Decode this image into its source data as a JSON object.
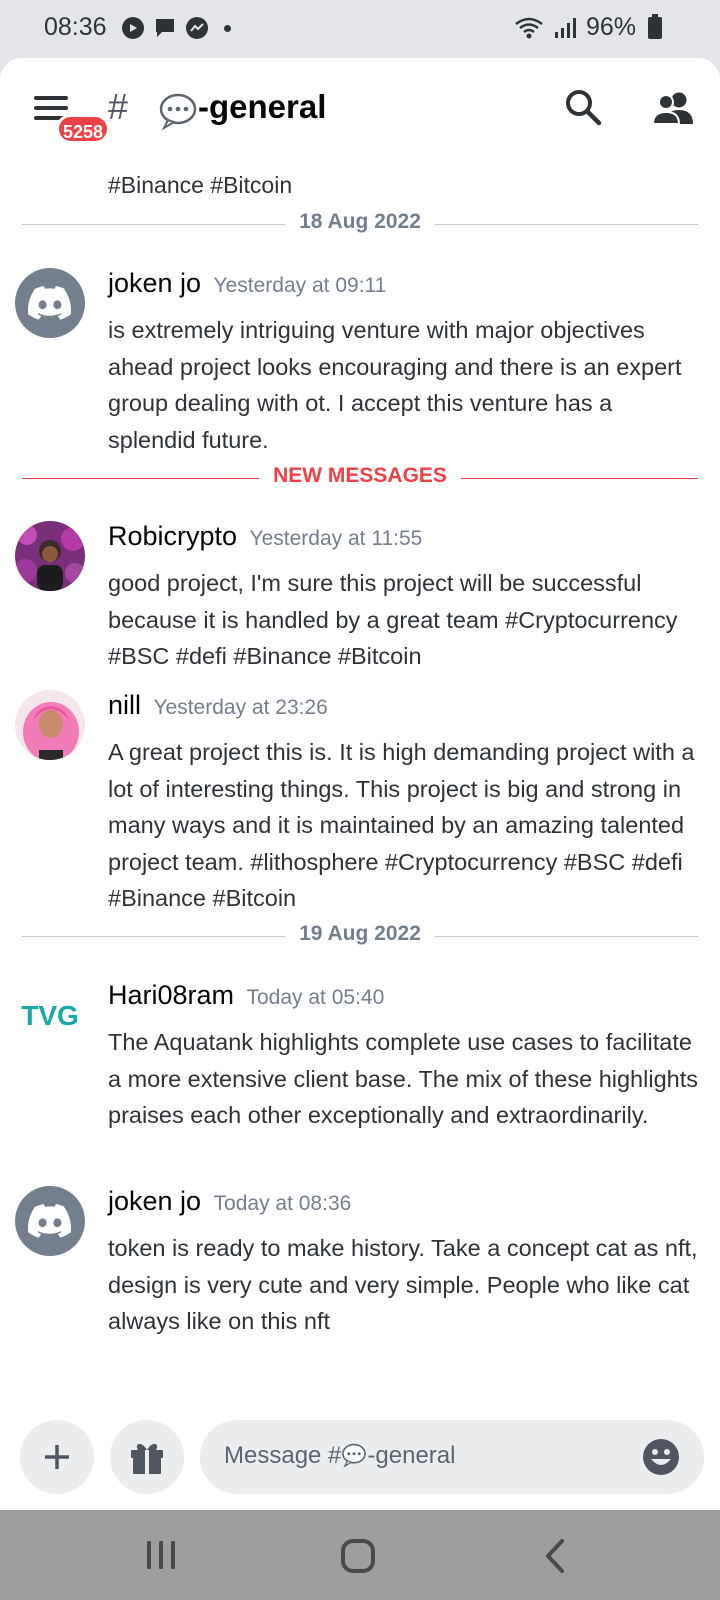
{
  "status_bar": {
    "time": "08:36",
    "battery": "96%",
    "icons": [
      "play-icon",
      "message-icon",
      "messenger-icon",
      "dot-icon",
      "wifi-icon",
      "signal-icon",
      "battery-icon"
    ]
  },
  "header": {
    "unread_badge": "5258",
    "hash_symbol": "#",
    "channel_name": "-general",
    "icons": [
      "menu-icon",
      "speech-bubble-emoji",
      "search-icon",
      "members-icon"
    ]
  },
  "chat": {
    "cut_off_text": "#Binance #Bitcoin",
    "dividers": {
      "first": "18 Aug 2022",
      "new_messages": "NEW MESSAGES",
      "second": "19 Aug 2022"
    },
    "messages": [
      {
        "author": "joken  jo",
        "timestamp": "Yesterday at 09:11",
        "avatar": "discord-default-avatar",
        "text": "is extremely intriguing venture with major objectives ahead project looks encouraging and there is an expert group dealing with ot. I accept this venture has a splendid future."
      },
      {
        "author": "Robicrypto",
        "timestamp": "Yesterday at 11:55",
        "avatar": "user-photo-avatar",
        "text": "good project, I'm sure this project will be successful because it is handled by a great team #Cryptocurrency #BSC #defi #Binance #Bitcoin"
      },
      {
        "author": "nill",
        "timestamp": "Yesterday at 23:26",
        "avatar": "user-photo-avatar",
        "text": "A great project this is. It is high demanding project with a lot of interesting things. This project is big and strong in many ways and it is maintained by an amazing talented project team. #lithosphere #Cryptocurrency #BSC #defi #Binance #Bitcoin"
      },
      {
        "author": "Hari08ram",
        "timestamp": "Today at 05:40",
        "avatar": "tvg-logo-avatar",
        "avatar_logo_text": "TVG",
        "text": "The Aquatank highlights complete use cases to facilitate a more extensive client base. The mix of these highlights praises each other exceptionally and extraordinarily."
      },
      {
        "author": "joken  jo",
        "timestamp": "Today at 08:36",
        "avatar": "discord-default-avatar",
        "text": "token is ready to make history. Take a concept cat as nft, design is very cute and very simple. People who like cat always like on this nft"
      }
    ]
  },
  "composer": {
    "placeholder_prefix": "Message #",
    "placeholder_suffix": "-general",
    "icons": [
      "plus-icon",
      "gift-icon",
      "emoji-icon"
    ]
  },
  "navbar": {
    "icons": [
      "recent-apps-icon",
      "home-icon",
      "back-icon"
    ]
  },
  "colors": {
    "accent_red": "#ed4245",
    "discord_gray": "#747f8d",
    "tvg_teal": "#1aa8a8"
  }
}
